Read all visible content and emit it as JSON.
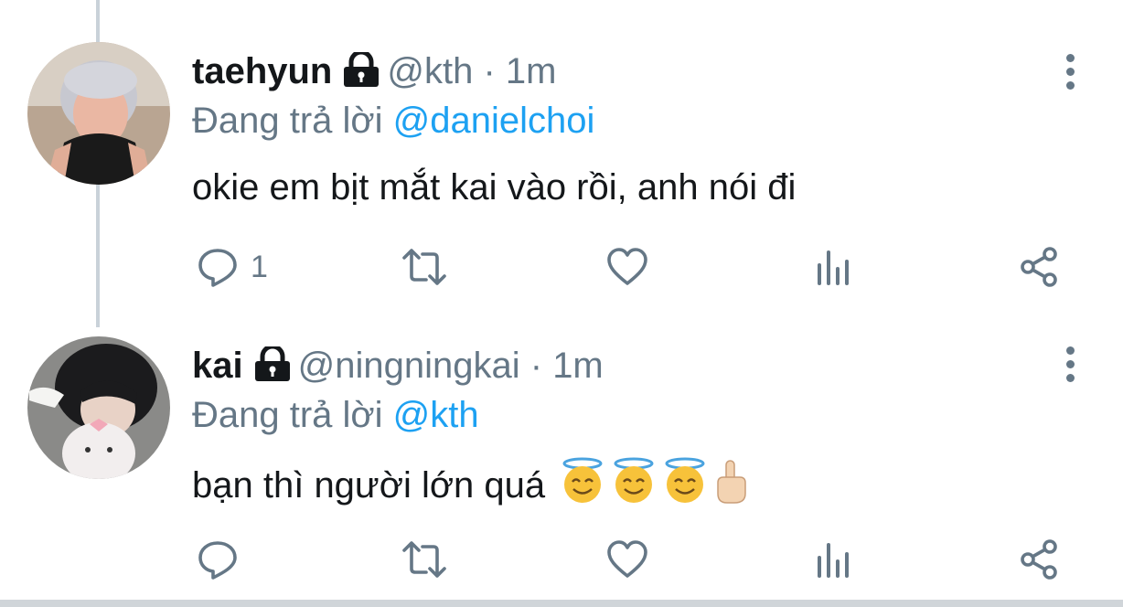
{
  "tweets": [
    {
      "name": "taehyun",
      "handle": "@kth",
      "separator": "·",
      "time": "1m",
      "reply_prefix": "Đang trả lời",
      "reply_to": "@danielchoi",
      "text": "okie em bịt mắt kai vào rồi, anh nói đi",
      "reply_count": "1",
      "emoji": []
    },
    {
      "name": "kai",
      "handle": "@ningningkai",
      "separator": "·",
      "time": "1m",
      "reply_prefix": "Đang trả lời",
      "reply_to": "@kth",
      "text": "bạn thì người lớn quá",
      "reply_count": "",
      "emoji": [
        "smiling-face-with-halo",
        "smiling-face-with-halo",
        "smiling-face-with-halo",
        "middle-finger"
      ]
    }
  ],
  "colors": {
    "text_primary": "#14171a",
    "text_secondary": "#657786",
    "link": "#1da1f2",
    "thread_line": "#c9d2d9"
  },
  "icons": [
    "lock-icon",
    "reply-icon",
    "retweet-icon",
    "like-icon",
    "analytics-icon",
    "share-icon",
    "more-icon"
  ]
}
